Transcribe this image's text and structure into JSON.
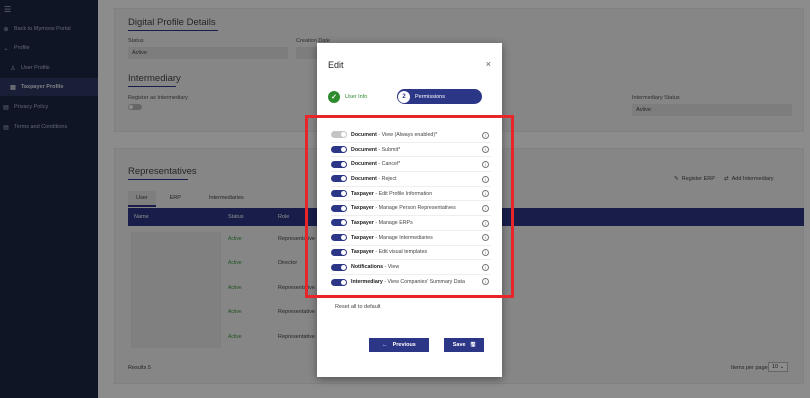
{
  "sidebar": {
    "items": [
      {
        "label": "Back to Mymoos Portal",
        "icon": "back-circle-icon"
      },
      {
        "label": "Profile",
        "icon": "chevron-down-icon"
      },
      {
        "label": "User Profile",
        "icon": "user-icon"
      },
      {
        "label": "Taxpayer Profile",
        "icon": "document-icon"
      },
      {
        "label": "Privacy Policy",
        "icon": "document-icon"
      },
      {
        "label": "Terms and Conditions",
        "icon": "document-icon"
      }
    ]
  },
  "digital_profile": {
    "title": "Digital Profile Details",
    "status_label": "Status",
    "status_value": "Active",
    "creation_label": "Creation Date"
  },
  "intermediary": {
    "title": "Intermediary",
    "register_label": "Register as Intermediary",
    "status_label": "Intermediary Status",
    "status_value": "Active"
  },
  "representatives": {
    "title": "Representatives",
    "tabs": [
      "User",
      "ERP",
      "Intermediaries"
    ],
    "register_erp": "Register ERP",
    "add_intermediary": "Add Intermediary",
    "columns": [
      "Name",
      "Status",
      "Role"
    ],
    "rows": [
      {
        "status": "Active",
        "role": "Representative"
      },
      {
        "status": "Active",
        "role": "Director"
      },
      {
        "status": "Active",
        "role": "Representative"
      },
      {
        "status": "Active",
        "role": "Representative"
      },
      {
        "status": "Active",
        "role": "Representative"
      }
    ],
    "results": "Results 5",
    "items_per_page_label": "Items per page",
    "items_per_page_value": "10"
  },
  "modal": {
    "title": "Edit",
    "close": "×",
    "steps": [
      {
        "label": "User Info",
        "state": "done"
      },
      {
        "number": "2",
        "label": "Permissions",
        "state": "active"
      }
    ],
    "permissions": [
      {
        "entity": "Document",
        "action": " - View (Always enabled)*",
        "enabled": false
      },
      {
        "entity": "Document",
        "action": " - Submit*",
        "enabled": true
      },
      {
        "entity": "Document",
        "action": " - Cancel*",
        "enabled": true
      },
      {
        "entity": "Document",
        "action": " - Reject",
        "enabled": true
      },
      {
        "entity": "Taxpayer",
        "action": " - Edit Profile Information",
        "enabled": true
      },
      {
        "entity": "Taxpayer",
        "action": " - Manage Person Representatives",
        "enabled": true
      },
      {
        "entity": "Taxpayer",
        "action": " - Manage ERPs",
        "enabled": true
      },
      {
        "entity": "Taxpayer",
        "action": " - Manage Intermediaries",
        "enabled": true
      },
      {
        "entity": "Taxpayer",
        "action": " - Edit visual templates",
        "enabled": true
      },
      {
        "entity": "Notifications",
        "action": " - View",
        "enabled": true
      },
      {
        "entity": "Intermediary",
        "action": " - View Companies' Summary Data",
        "enabled": true
      }
    ],
    "reset_label": "Reset all to default",
    "previous_label": "Previous",
    "save_label": "Save"
  },
  "colors": {
    "primary": "#2c3687",
    "sidebar": "#1d2744",
    "highlight": "#e8262a",
    "success": "#2e8b2e"
  }
}
